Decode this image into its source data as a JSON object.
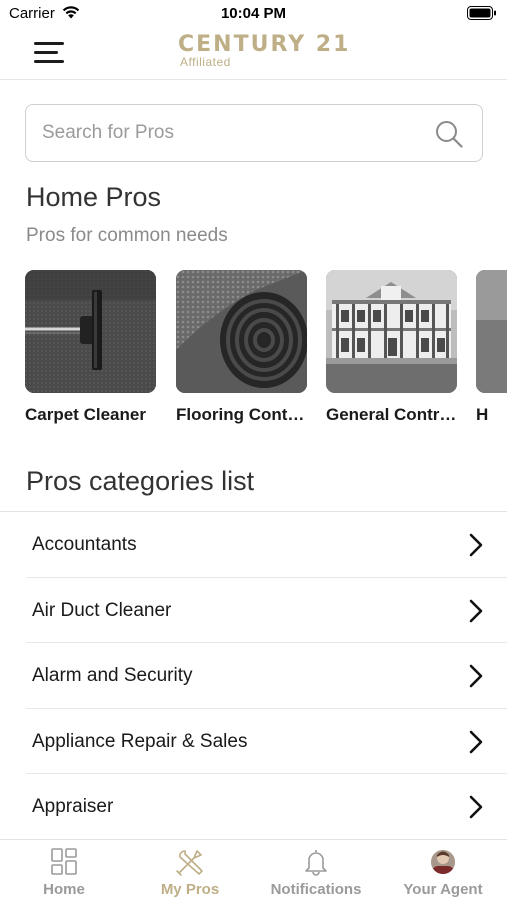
{
  "status_bar": {
    "carrier": "Carrier",
    "time": "10:04 PM"
  },
  "header": {
    "brand": "CENTURY 21",
    "brand_sub": "Affiliated",
    "brand_color": "#beaf87"
  },
  "search": {
    "placeholder": "Search for Pros",
    "value": ""
  },
  "home_pros": {
    "title": "Home Pros",
    "subtitle": "Pros for common needs",
    "cards": [
      {
        "label": "Carpet Cleaner",
        "image": "carpet-vacuum-photo"
      },
      {
        "label": "Flooring Contr...",
        "image": "rolled-carpet-photo"
      },
      {
        "label": "General Contra...",
        "image": "mansion-house-photo"
      },
      {
        "label": "H",
        "image": "partial-photo"
      }
    ]
  },
  "categories": {
    "title": "Pros categories list",
    "items": [
      {
        "label": "Accountants"
      },
      {
        "label": "Air Duct Cleaner"
      },
      {
        "label": "Alarm and Security"
      },
      {
        "label": "Appliance Repair & Sales"
      },
      {
        "label": "Appraiser"
      }
    ]
  },
  "tabbar": {
    "active_color": "#beaf87",
    "inactive_color": "#9a9a9a",
    "tabs": [
      {
        "label": "Home",
        "icon": "grid-icon",
        "active": false
      },
      {
        "label": "My Pros",
        "icon": "tools-icon",
        "active": true
      },
      {
        "label": "Notifications",
        "icon": "bell-icon",
        "active": false
      },
      {
        "label": "Your Agent",
        "icon": "avatar-icon",
        "active": false
      }
    ]
  }
}
